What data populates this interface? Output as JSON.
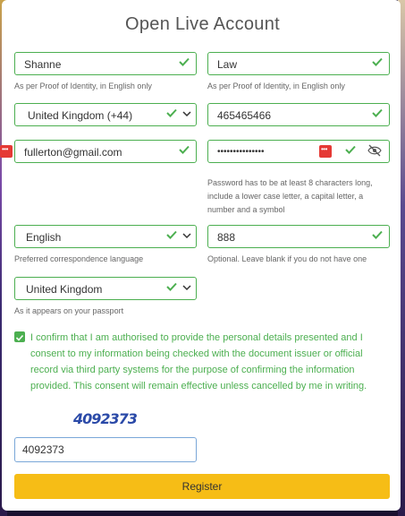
{
  "form": {
    "title": "Open Live Account",
    "first_name": {
      "value": "Shanne",
      "hint": "As per Proof of Identity, in English only"
    },
    "last_name": {
      "value": "Law",
      "hint": "As per Proof of Identity, in English only"
    },
    "country_code": {
      "value": "United Kingdom (+44)"
    },
    "phone": {
      "value": "465465466"
    },
    "email": {
      "value": "fullerton@gmail.com"
    },
    "password": {
      "masked": "•••••••••••••••",
      "hint": "Password has to be at least 8 characters long, include a lower case letter, a capital letter, a number and a symbol"
    },
    "language": {
      "value": "English",
      "hint": "Preferred correspondence language"
    },
    "referral": {
      "value": "888",
      "hint": "Optional. Leave blank if you do not have one"
    },
    "passport_country": {
      "value": "United Kingdom",
      "hint": "As it appears on your passport"
    },
    "consent": {
      "checked": true,
      "text": "I confirm that I am authorised to provide the personal details presented and I consent to my information being checked with the document issuer or official record via third party systems for the purpose of confirming the information provided. This consent will remain effective unless cancelled by me in writing."
    },
    "captcha": {
      "image_text": "4092373",
      "input_value": "4092373"
    },
    "register_label": "Register"
  },
  "colors": {
    "valid": "#4caf50",
    "accent_button": "#f6bd16",
    "captcha_text": "#2b4aa8",
    "error_badge": "#e53935"
  },
  "icons": [
    "check-icon",
    "chevron-down-icon",
    "eye-slash-icon",
    "password-manager-icon"
  ]
}
